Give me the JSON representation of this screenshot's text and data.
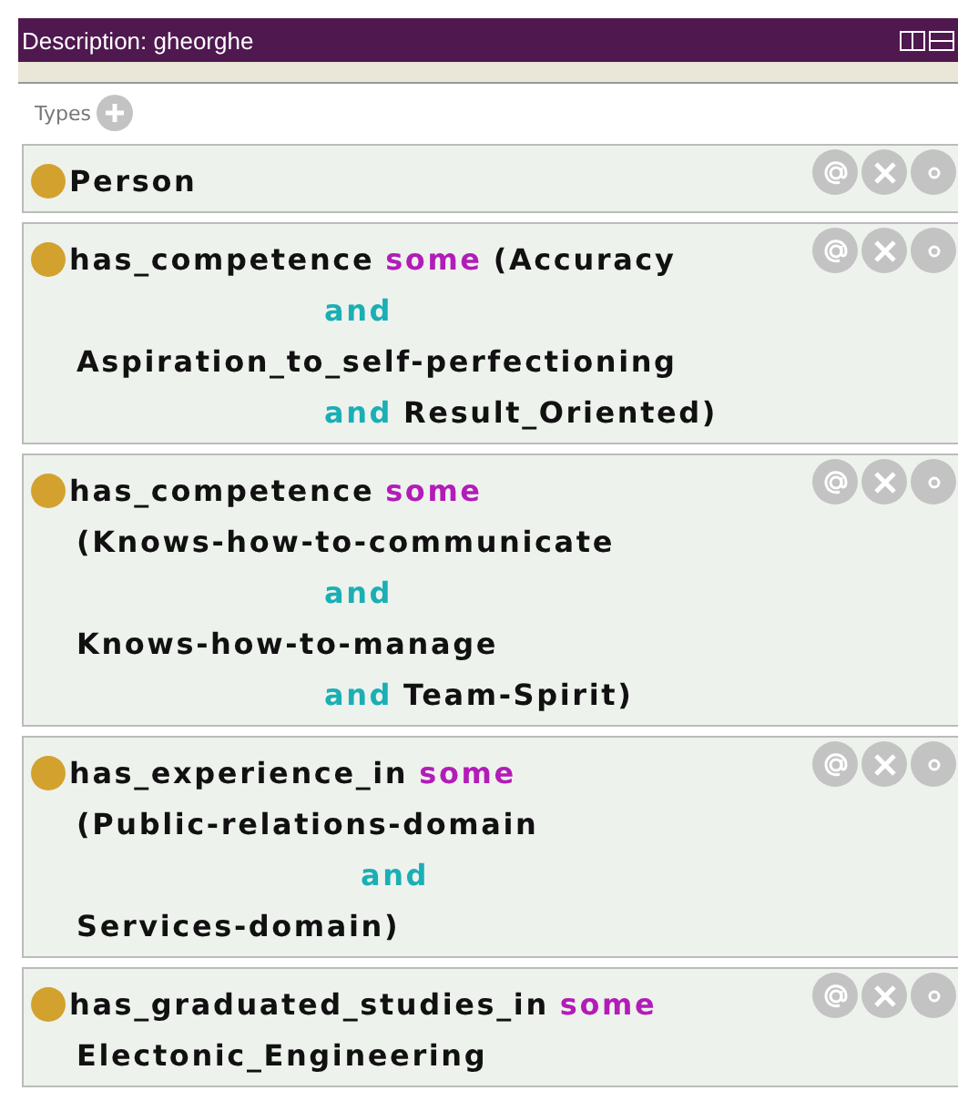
{
  "panel": {
    "title": "Description: gheorghe"
  },
  "section": {
    "label": "Types"
  },
  "entries": [
    {
      "lines": [
        {
          "kind": "first",
          "tokens": [
            {
              "kind": "name",
              "text": "Person"
            }
          ]
        }
      ]
    },
    {
      "lines": [
        {
          "kind": "first",
          "tokens": [
            {
              "kind": "name",
              "text": "has_competence"
            },
            {
              "kind": "keyword",
              "text": "some"
            },
            {
              "kind": "name",
              "text": "(Accuracy"
            }
          ]
        },
        {
          "kind": "indented",
          "tokens": [
            {
              "kind": "connective",
              "text": "and"
            }
          ]
        },
        {
          "kind": "plain",
          "tokens": [
            {
              "kind": "name",
              "text": "Aspiration_to_self-perfectioning"
            }
          ]
        },
        {
          "kind": "indented",
          "tokens": [
            {
              "kind": "connective",
              "text": "and"
            },
            {
              "kind": "name",
              "text": "Result_Oriented)"
            }
          ]
        }
      ]
    },
    {
      "lines": [
        {
          "kind": "first",
          "tokens": [
            {
              "kind": "name",
              "text": "has_competence"
            },
            {
              "kind": "keyword",
              "text": "some"
            }
          ]
        },
        {
          "kind": "plain",
          "tokens": [
            {
              "kind": "name",
              "text": "(Knows-how-to-communicate"
            }
          ]
        },
        {
          "kind": "indented",
          "tokens": [
            {
              "kind": "connective",
              "text": "and"
            }
          ]
        },
        {
          "kind": "plain",
          "tokens": [
            {
              "kind": "name",
              "text": "Knows-how-to-manage"
            }
          ]
        },
        {
          "kind": "indented",
          "tokens": [
            {
              "kind": "connective",
              "text": "and"
            },
            {
              "kind": "name",
              "text": "Team-Spirit)"
            }
          ]
        }
      ]
    },
    {
      "lines": [
        {
          "kind": "first",
          "tokens": [
            {
              "kind": "name",
              "text": "has_experience_in"
            },
            {
              "kind": "keyword",
              "text": "some"
            }
          ]
        },
        {
          "kind": "plain",
          "tokens": [
            {
              "kind": "name",
              "text": "(Public-relations-domain"
            }
          ]
        },
        {
          "kind": "deep",
          "tokens": [
            {
              "kind": "connective",
              "text": "and"
            }
          ]
        },
        {
          "kind": "plain",
          "tokens": [
            {
              "kind": "name",
              "text": "Services-domain)"
            }
          ]
        }
      ]
    },
    {
      "lines": [
        {
          "kind": "first",
          "tokens": [
            {
              "kind": "name",
              "text": "has_graduated_studies_in"
            },
            {
              "kind": "keyword",
              "text": "some"
            }
          ]
        },
        {
          "kind": "plain",
          "tokens": [
            {
              "kind": "name",
              "text": "Electonic_Engineering"
            }
          ]
        }
      ]
    }
  ]
}
